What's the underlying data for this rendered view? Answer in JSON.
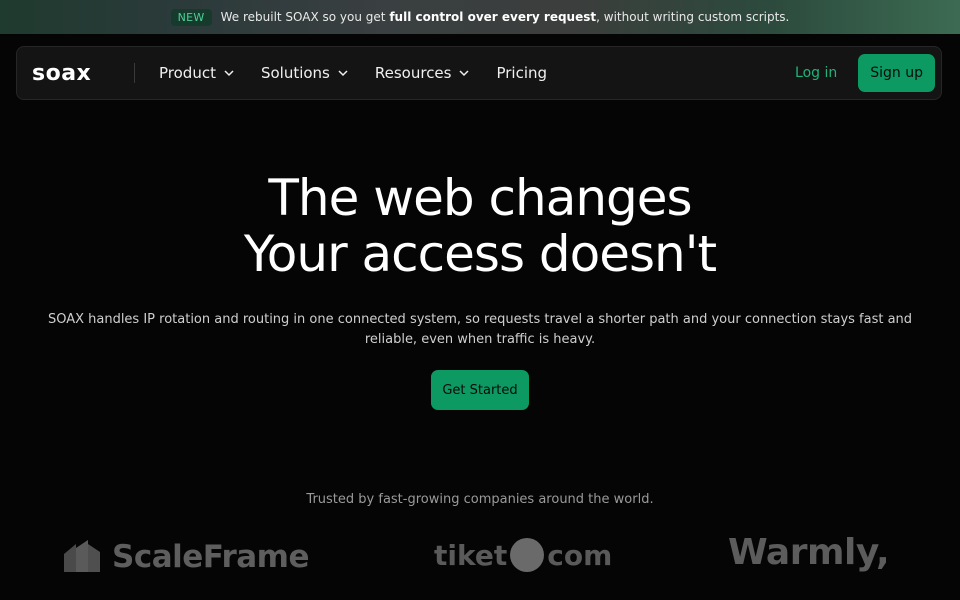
{
  "announcement": {
    "badge": "NEW",
    "text_before": "We rebuilt SOAX so you get ",
    "text_bold": "full control over every request",
    "text_after": ", without writing custom scripts."
  },
  "nav": {
    "logo": "soax",
    "items": [
      {
        "label": "Product",
        "has_dropdown": true
      },
      {
        "label": "Solutions",
        "has_dropdown": true
      },
      {
        "label": "Resources",
        "has_dropdown": true
      },
      {
        "label": "Pricing",
        "has_dropdown": false
      }
    ],
    "login_label": "Log in",
    "signup_label": "Sign up"
  },
  "hero": {
    "title_line1": "The web changes",
    "title_line2": "Your access doesn't",
    "subtitle": "SOAX handles IP rotation and routing in one connected system, so requests travel a shorter path and your connection stays fast and reliable, even when traffic is heavy.",
    "cta_label": "Get Started"
  },
  "trust": {
    "caption": "Trusted by fast-growing companies around the world.",
    "logos": [
      {
        "name": "ScaleFrame",
        "icon": "scaleframe-icon"
      },
      {
        "name_left": "tiket",
        "name_right": "com"
      },
      {
        "name": "Warmly,"
      }
    ]
  },
  "colors": {
    "accent": "#0c9a62",
    "accent_text": "#21b37a",
    "background": "#050505"
  }
}
